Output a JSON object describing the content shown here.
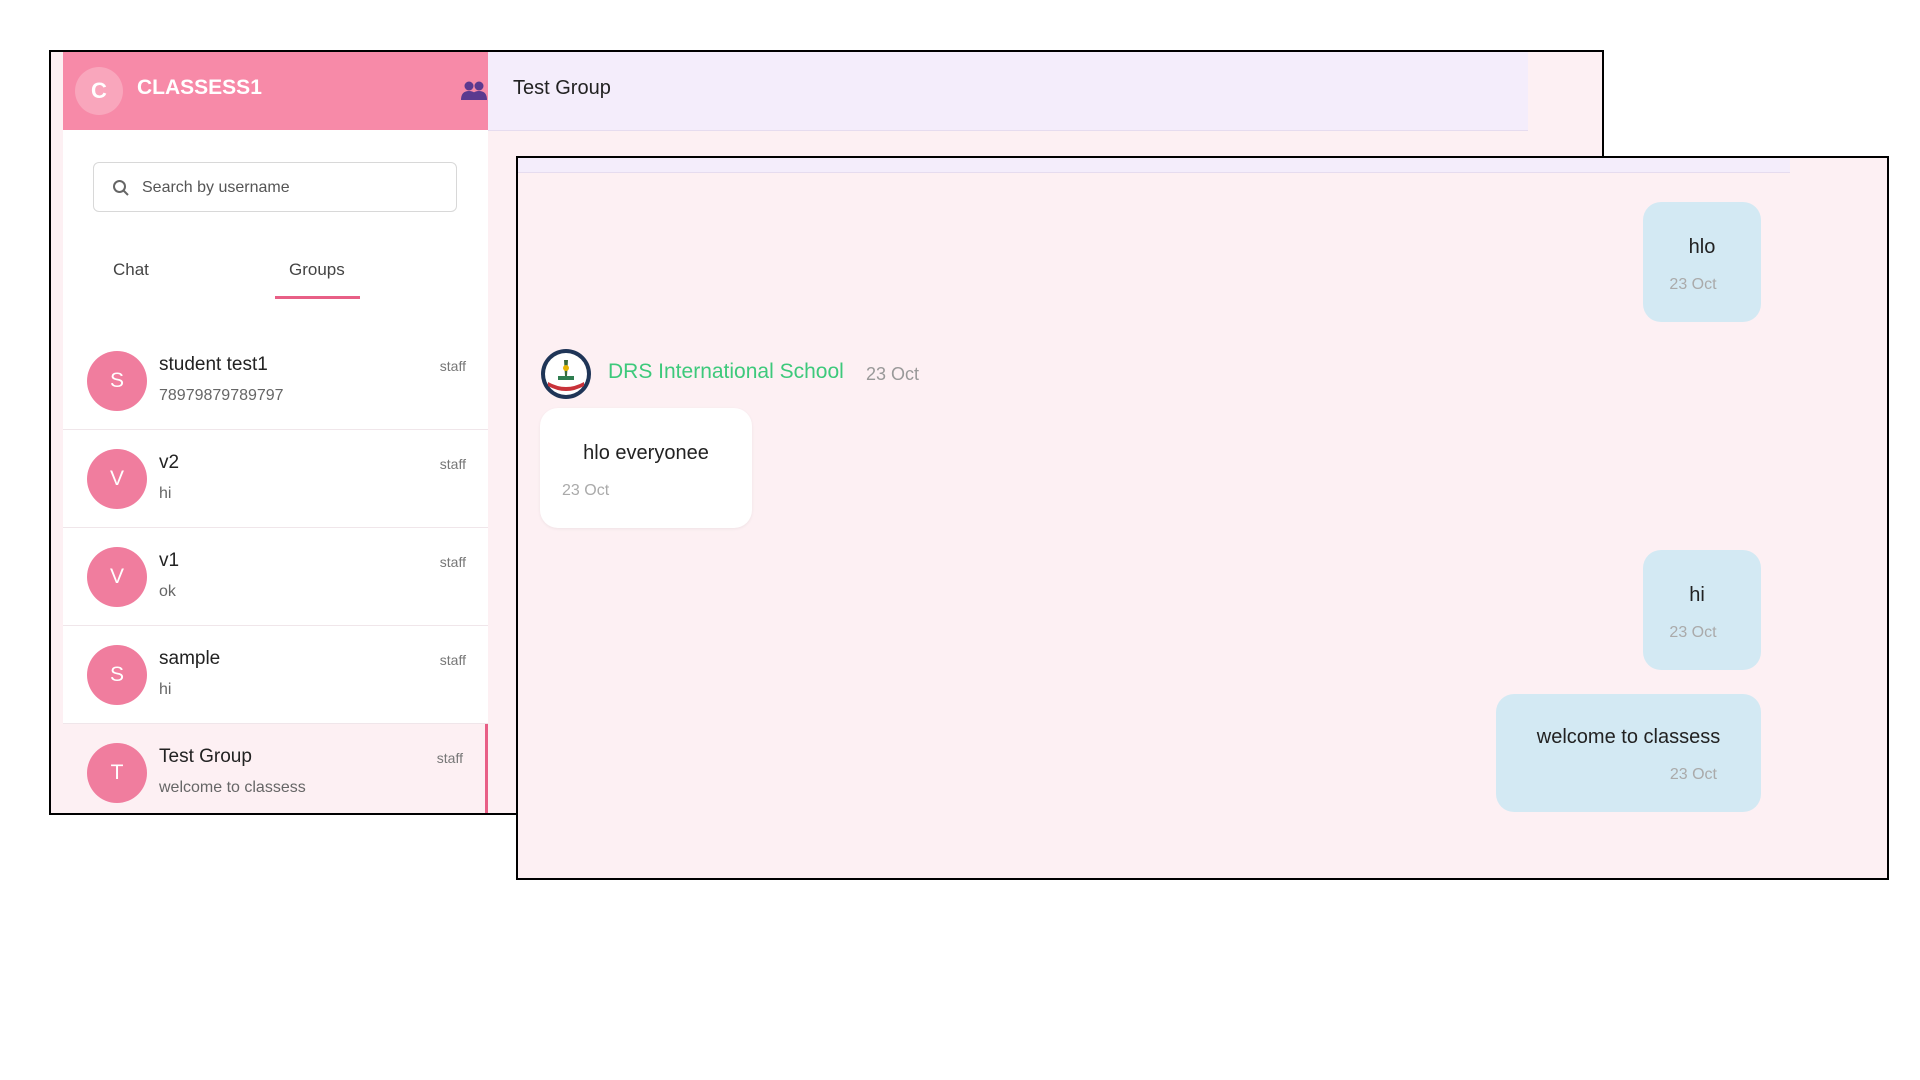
{
  "app": {
    "title": "CLASSESS1",
    "avatar_letter": "C"
  },
  "search": {
    "placeholder": "Search by username",
    "value": ""
  },
  "tabs": [
    {
      "label": "Chat",
      "active": false
    },
    {
      "label": "Groups",
      "active": true
    }
  ],
  "contacts": [
    {
      "letter": "S",
      "name": "student test1",
      "last_message": "78979879789797",
      "role": "staff"
    },
    {
      "letter": "V",
      "name": "v2",
      "last_message": "hi",
      "role": "staff"
    },
    {
      "letter": "V",
      "name": "v1",
      "last_message": "ok",
      "role": "staff"
    },
    {
      "letter": "S",
      "name": "sample",
      "last_message": "hi",
      "role": "staff"
    },
    {
      "letter": "T",
      "name": "Test Group",
      "last_message": "welcome to classess",
      "role": "staff",
      "active": true
    }
  ],
  "chat": {
    "title": "Test Group",
    "messages": [
      {
        "direction": "out",
        "text": "hlo",
        "time": "23 Oct"
      },
      {
        "direction": "in",
        "sender": "DRS International School",
        "sender_time": "23 Oct",
        "text": "hlo everyonee",
        "time": "23 Oct"
      },
      {
        "direction": "out",
        "text": "hi",
        "time": "23 Oct"
      },
      {
        "direction": "out",
        "text": "welcome to classess",
        "time": "23 Oct"
      }
    ]
  },
  "colors": {
    "accent": "#f78aa8",
    "avatar": "#f07d9e",
    "sender_name": "#3dc97b",
    "outgoing_bubble": "#d3e9f3",
    "chat_background": "#fdf0f3"
  },
  "icons": {
    "group": "group-icon",
    "search": "search-icon",
    "sender_logo": "school-logo-icon"
  }
}
